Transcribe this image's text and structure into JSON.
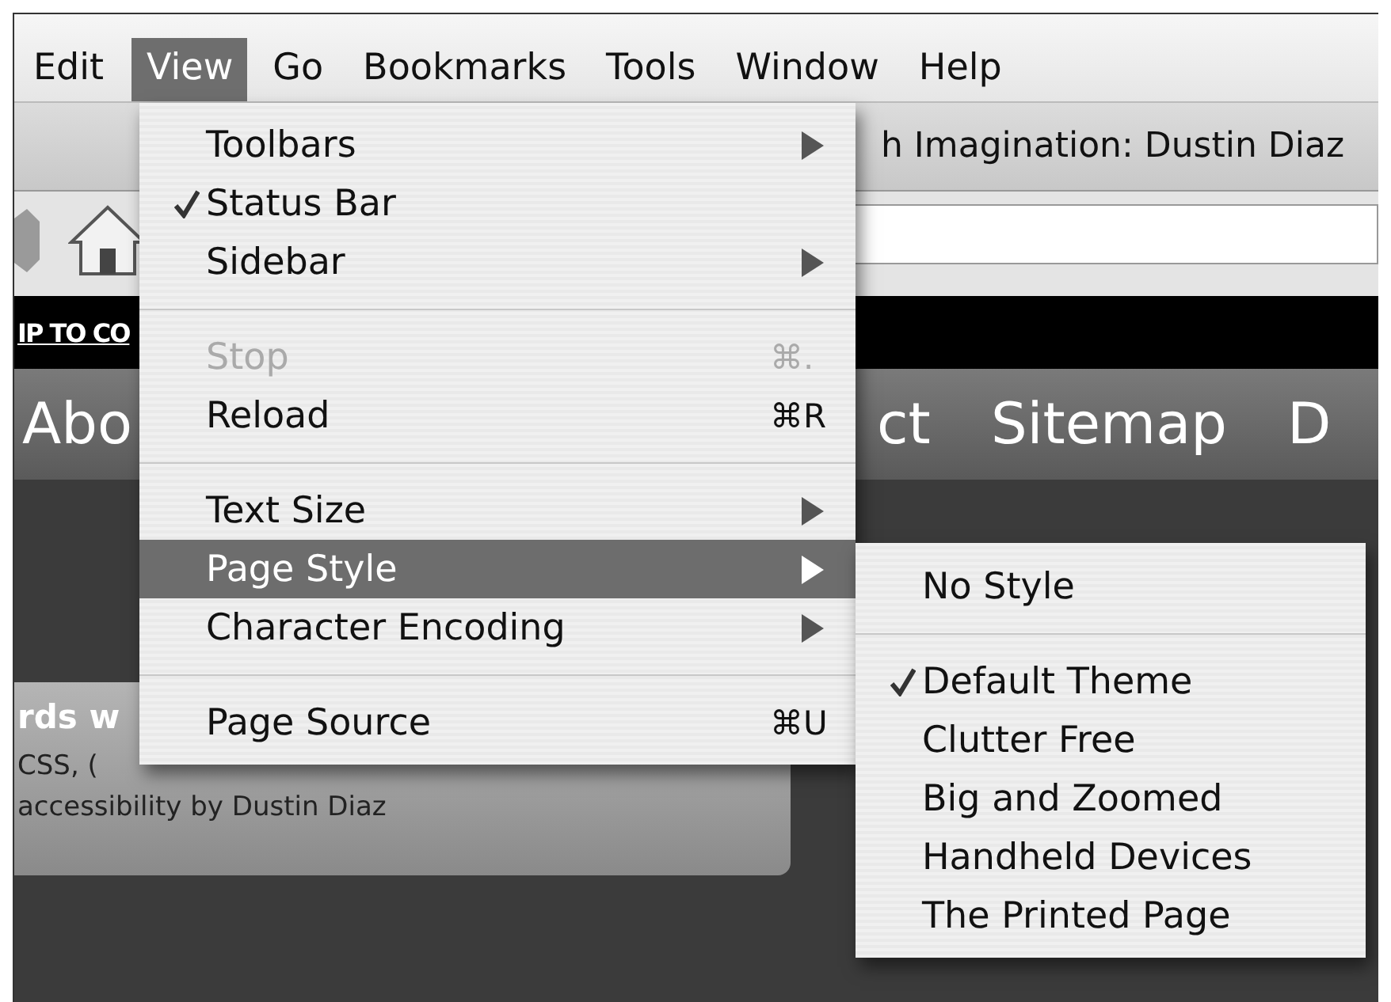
{
  "menu_bar": [
    {
      "label": "Edit",
      "selected": false
    },
    {
      "label": "View",
      "selected": true
    },
    {
      "label": "Go",
      "selected": false
    },
    {
      "label": "Bookmarks",
      "selected": false
    },
    {
      "label": "Tools",
      "selected": false
    },
    {
      "label": "Window",
      "selected": false
    },
    {
      "label": "Help",
      "selected": false
    }
  ],
  "window_title": "h Imagination: Dustin Diaz",
  "skip_link": "IP TO CO",
  "nav_links": [
    "Abo",
    "ct",
    "Sitemap",
    "D"
  ],
  "panel": {
    "heading": "rds w",
    "lines": [
      "CSS, (",
      "accessibility by Dustin Diaz"
    ]
  },
  "view_menu": [
    {
      "kind": "item",
      "label": "Toolbars",
      "checked": false,
      "disabled": false,
      "selected": false,
      "submenu": true
    },
    {
      "kind": "item",
      "label": "Status Bar",
      "checked": true,
      "disabled": false,
      "selected": false,
      "submenu": false
    },
    {
      "kind": "item",
      "label": "Sidebar",
      "checked": false,
      "disabled": false,
      "selected": false,
      "submenu": true
    },
    {
      "kind": "separator"
    },
    {
      "kind": "item",
      "label": "Stop",
      "shortcut": "⌘.",
      "checked": false,
      "disabled": true,
      "selected": false,
      "submenu": false
    },
    {
      "kind": "item",
      "label": "Reload",
      "shortcut": "⌘R",
      "checked": false,
      "disabled": false,
      "selected": false,
      "submenu": false
    },
    {
      "kind": "separator"
    },
    {
      "kind": "item",
      "label": "Text Size",
      "checked": false,
      "disabled": false,
      "selected": false,
      "submenu": true
    },
    {
      "kind": "item",
      "label": "Page Style",
      "checked": false,
      "disabled": false,
      "selected": true,
      "submenu": true
    },
    {
      "kind": "item",
      "label": "Character Encoding",
      "checked": false,
      "disabled": false,
      "selected": false,
      "submenu": true
    },
    {
      "kind": "separator"
    },
    {
      "kind": "item",
      "label": "Page Source",
      "shortcut": "⌘U",
      "checked": false,
      "disabled": false,
      "selected": false,
      "submenu": false
    }
  ],
  "page_style_menu": [
    {
      "kind": "item",
      "label": "No Style",
      "checked": false,
      "disabled": false,
      "selected": false,
      "submenu": false
    },
    {
      "kind": "separator"
    },
    {
      "kind": "item",
      "label": "Default Theme",
      "checked": true,
      "disabled": false,
      "selected": false,
      "submenu": false
    },
    {
      "kind": "item",
      "label": "Clutter Free",
      "checked": false,
      "disabled": false,
      "selected": false,
      "submenu": false
    },
    {
      "kind": "item",
      "label": "Big and Zoomed",
      "checked": false,
      "disabled": false,
      "selected": false,
      "submenu": false
    },
    {
      "kind": "item",
      "label": "Handheld Devices",
      "checked": false,
      "disabled": false,
      "selected": false,
      "submenu": false
    },
    {
      "kind": "item",
      "label": "The Printed Page",
      "checked": false,
      "disabled": false,
      "selected": false,
      "submenu": false
    }
  ]
}
